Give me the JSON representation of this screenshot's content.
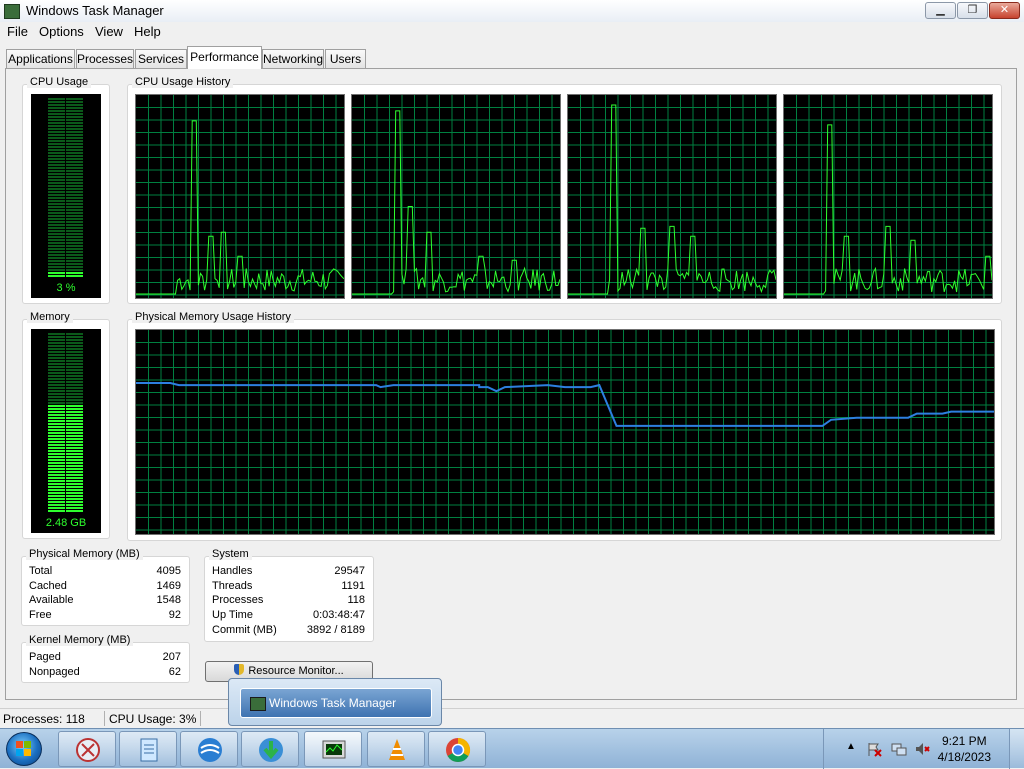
{
  "window": {
    "title": "Windows Task Manager",
    "controls": {
      "minimize": "▁",
      "maximize": "❐",
      "close": "✕"
    }
  },
  "menu": [
    "File",
    "Options",
    "View",
    "Help"
  ],
  "tabs": [
    {
      "label": "Applications",
      "active": false
    },
    {
      "label": "Processes",
      "active": false
    },
    {
      "label": "Services",
      "active": false
    },
    {
      "label": "Performance",
      "active": true
    },
    {
      "label": "Networking",
      "active": false
    },
    {
      "label": "Users",
      "active": false
    }
  ],
  "cpu": {
    "usage_title": "CPU Usage",
    "usage_value": "3 %",
    "usage_fraction": 0.03,
    "history_title": "CPU Usage History"
  },
  "memory": {
    "title": "Memory",
    "value": "2.48 GB",
    "usage_fraction": 0.6,
    "history_title": "Physical Memory Usage History"
  },
  "physical_memory": {
    "title": "Physical Memory (MB)",
    "rows": [
      {
        "label": "Total",
        "value": "4095"
      },
      {
        "label": "Cached",
        "value": "1469"
      },
      {
        "label": "Available",
        "value": "1548"
      },
      {
        "label": "Free",
        "value": "92"
      }
    ]
  },
  "kernel_memory": {
    "title": "Kernel Memory (MB)",
    "rows": [
      {
        "label": "Paged",
        "value": "207"
      },
      {
        "label": "Nonpaged",
        "value": "62"
      }
    ]
  },
  "system": {
    "title": "System",
    "rows": [
      {
        "label": "Handles",
        "value": "29547"
      },
      {
        "label": "Threads",
        "value": "1191"
      },
      {
        "label": "Processes",
        "value": "118"
      },
      {
        "label": "Up Time",
        "value": "0:03:48:47"
      },
      {
        "label": "Commit (MB)",
        "value": "3892 / 8189"
      }
    ]
  },
  "resource_monitor_button": "Resource Monitor...",
  "statusbar": {
    "processes": "Processes: 118",
    "cpu_usage": "CPU Usage: 3%"
  },
  "taskbar": {
    "popup_title": "Windows Task Manager",
    "time": "9:21 PM",
    "date": "4/18/2023",
    "apps": [
      "snipping-tool",
      "notepad-app",
      "network-app",
      "download-manager",
      "task-manager",
      "vlc-player",
      "chrome-browser"
    ]
  },
  "colors": {
    "grid": "#008040",
    "cpu_line": "#2eff2e",
    "mem_line": "#2d7fe0",
    "meter_on": "#2eff2e",
    "meter_off": "#0b5a1a"
  }
}
